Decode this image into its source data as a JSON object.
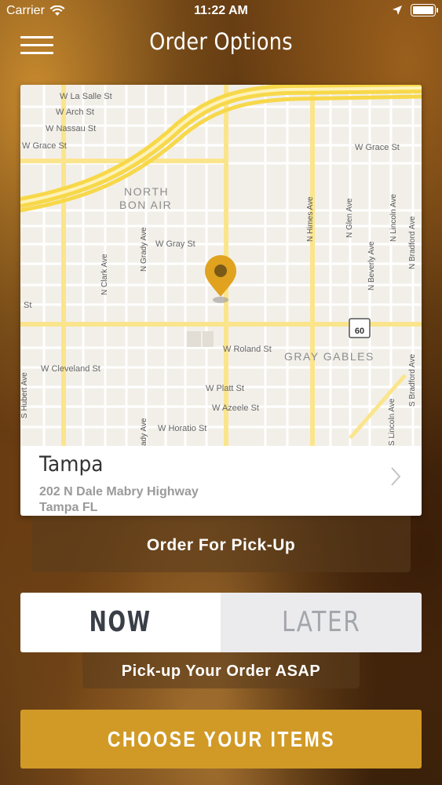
{
  "status_bar": {
    "carrier": "Carrier",
    "time": "11:22 AM"
  },
  "header": {
    "title": "Order Options"
  },
  "map": {
    "street_labels": [
      "W La Salle St",
      "W Arch St",
      "W Nassau St",
      "W Grace St",
      "W Grace St",
      "NORTH",
      "BON AIR",
      "N Himes Ave",
      "N Glen Ave",
      "N Lincoln Ave",
      "N Bradford Ave",
      "W Gray St",
      "N Grady Ave",
      "N Clark Ave",
      "N Beverly Ave",
      "St",
      "W Roland St",
      "GRAY GABLES",
      "W Cleveland St",
      "W Platt St",
      "W Azeele St",
      "W Horatio St",
      "S Lincoln Ave",
      "S Bradford Ave",
      "ady Ave",
      "S Hubert Ave"
    ],
    "highway_shield": "60",
    "pin_color": "#e0a21f"
  },
  "location": {
    "name": "Tampa",
    "address": "202 N Dale Mabry Highway",
    "city": "Tampa FL"
  },
  "order_type": {
    "label": "Order For Pick-Up"
  },
  "timing": {
    "now_label": "NOW",
    "later_label": "LATER",
    "selected": "NOW",
    "note": "Pick-up Your Order ASAP"
  },
  "cta": {
    "label": "CHOOSE YOUR ITEMS",
    "color": "#d19a26"
  }
}
